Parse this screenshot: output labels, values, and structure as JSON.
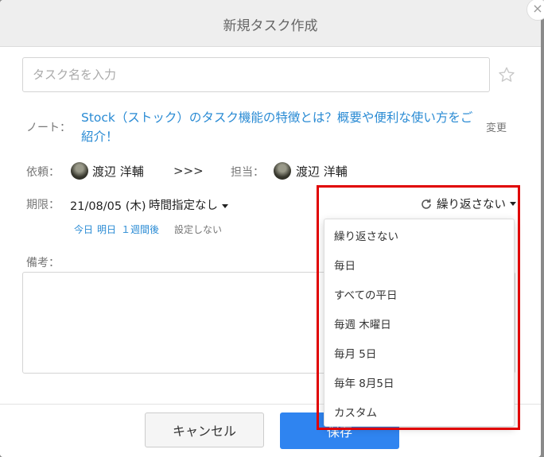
{
  "modal": {
    "title": "新規タスク作成",
    "close_label": "×"
  },
  "task": {
    "placeholder": "タスク名を入力"
  },
  "note": {
    "label": "ノート：",
    "link_text": "Stock（ストック）のタスク機能の特徴とは？概要や便利な使い方をご紹介！",
    "change_label": "変更"
  },
  "request": {
    "requester_label": "依頼：",
    "requester_name": "渡辺 洋輔",
    "arrow": ">>>",
    "assignee_label": "担当：",
    "assignee_name": "渡辺 洋輔"
  },
  "deadline": {
    "label": "期限：",
    "date": "21/08/05 (木)",
    "time_select": "時間指定なし",
    "quick_today": "今日",
    "quick_tomorrow": "明日",
    "quick_week": "１週間後",
    "quick_none": "設定しない"
  },
  "repeat": {
    "selected": "繰り返さない",
    "options": [
      "繰り返さない",
      "毎日",
      "すべての平日",
      "毎週 木曜日",
      "毎月 5日",
      "毎年 8月5日",
      "カスタム"
    ]
  },
  "memo": {
    "label": "備考："
  },
  "footer": {
    "cancel_label": "キャンセル",
    "save_label": "保存"
  },
  "colors": {
    "link": "#2a8bd4",
    "primary_button": "#2f84f0",
    "highlight_border": "#e00000"
  }
}
